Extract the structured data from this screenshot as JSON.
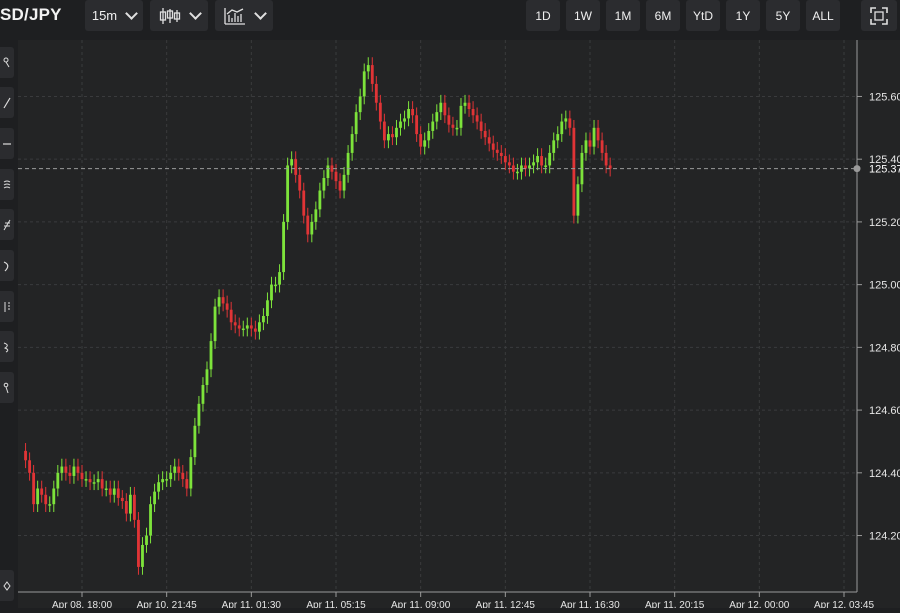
{
  "toolbar": {
    "symbol": "SD/JPY",
    "interval": "15m",
    "chart_type_icon": "candlestick-icon",
    "indicators_icon": "indicators-icon",
    "ranges": [
      "1D",
      "1W",
      "1M",
      "6M",
      "YtD",
      "1Y",
      "5Y",
      "ALL"
    ],
    "fullscreen_icon": "fullscreen-icon"
  },
  "left_tools": [
    "crosshair-icon",
    "trend-line-icon",
    "horizontal-line-icon",
    "pitchfork-icon",
    "fibonacci-icon",
    "pattern-icon",
    "measure-icon",
    "brush-icon",
    "annotation-icon",
    "settings-icon"
  ],
  "colors": {
    "background": "#232425",
    "up": "#7de33b",
    "down": "#e03436",
    "grid": "#3a3b3d",
    "axis_text": "#e6e6e6"
  },
  "chart_data": {
    "type": "candlestick",
    "grid": true,
    "y_ticks": [
      "124.20",
      "124.40",
      "124.60",
      "124.80",
      "125.00",
      "125.20",
      "125.40",
      "125.60"
    ],
    "ylim": [
      124.02,
      125.78
    ],
    "x_ticks": [
      "Apr 08, 18:00",
      "Apr 10, 21:45",
      "Apr 11, 01:30",
      "Apr 11, 05:15",
      "Apr 11, 09:00",
      "Apr 11, 12:45",
      "Apr 11, 16:30",
      "Apr 11, 20:15",
      "Apr 12, 00:00",
      "Apr 12, 03:45"
    ],
    "x_tick_indices": [
      14,
      35,
      56,
      77,
      98,
      119,
      140,
      161,
      182,
      203
    ],
    "last_price": "125.37",
    "last_value": 125.37,
    "closes": [
      124.44,
      124.4,
      124.3,
      124.35,
      124.33,
      124.3,
      124.3,
      124.35,
      124.4,
      124.42,
      124.4,
      124.39,
      124.42,
      124.4,
      124.38,
      124.38,
      124.37,
      124.37,
      124.38,
      124.35,
      124.35,
      124.33,
      124.35,
      124.32,
      124.31,
      124.27,
      124.33,
      124.25,
      124.1,
      124.17,
      124.2,
      124.3,
      124.34,
      124.37,
      124.38,
      124.38,
      124.4,
      124.42,
      124.4,
      124.38,
      124.35,
      124.45,
      124.55,
      124.62,
      124.68,
      124.73,
      124.82,
      124.93,
      124.96,
      124.94,
      124.92,
      124.88,
      124.87,
      124.86,
      124.86,
      124.87,
      124.86,
      124.85,
      124.88,
      124.9,
      124.95,
      125.0,
      125.0,
      125.04,
      125.2,
      125.38,
      125.4,
      125.35,
      125.3,
      125.22,
      125.16,
      125.2,
      125.24,
      125.3,
      125.34,
      125.38,
      125.36,
      125.33,
      125.3,
      125.35,
      125.42,
      125.48,
      125.55,
      125.6,
      125.68,
      125.7,
      125.64,
      125.58,
      125.52,
      125.46,
      125.48,
      125.47,
      125.5,
      125.52,
      125.53,
      125.56,
      125.54,
      125.48,
      125.44,
      125.46,
      125.49,
      125.52,
      125.55,
      125.58,
      125.54,
      125.51,
      125.5,
      125.5,
      125.57,
      125.58,
      125.56,
      125.54,
      125.52,
      125.49,
      125.47,
      125.45,
      125.43,
      125.42,
      125.41,
      125.39,
      125.38,
      125.36,
      125.36,
      125.38,
      125.37,
      125.38,
      125.39,
      125.41,
      125.38,
      125.38,
      125.42,
      125.46,
      125.48,
      125.52,
      125.53,
      125.5,
      125.22,
      125.32,
      125.42,
      125.46,
      125.44,
      125.5,
      125.46,
      125.42,
      125.38,
      125.37
    ],
    "opens": [
      124.47,
      124.44,
      124.4,
      124.3,
      124.35,
      124.33,
      124.3,
      124.3,
      124.35,
      124.4,
      124.42,
      124.4,
      124.39,
      124.42,
      124.4,
      124.38,
      124.38,
      124.37,
      124.37,
      124.38,
      124.35,
      124.35,
      124.33,
      124.35,
      124.32,
      124.31,
      124.27,
      124.33,
      124.25,
      124.1,
      124.17,
      124.2,
      124.3,
      124.34,
      124.37,
      124.38,
      124.38,
      124.4,
      124.42,
      124.4,
      124.38,
      124.35,
      124.45,
      124.55,
      124.62,
      124.68,
      124.73,
      124.82,
      124.93,
      124.96,
      124.94,
      124.92,
      124.88,
      124.87,
      124.86,
      124.86,
      124.87,
      124.86,
      124.85,
      124.88,
      124.9,
      124.95,
      125.0,
      125.0,
      125.04,
      125.2,
      125.38,
      125.4,
      125.35,
      125.3,
      125.22,
      125.16,
      125.2,
      125.24,
      125.3,
      125.34,
      125.38,
      125.36,
      125.33,
      125.3,
      125.35,
      125.42,
      125.48,
      125.55,
      125.6,
      125.68,
      125.7,
      125.64,
      125.58,
      125.52,
      125.46,
      125.48,
      125.47,
      125.5,
      125.52,
      125.53,
      125.56,
      125.54,
      125.48,
      125.44,
      125.46,
      125.49,
      125.52,
      125.55,
      125.58,
      125.54,
      125.51,
      125.5,
      125.5,
      125.57,
      125.58,
      125.56,
      125.54,
      125.52,
      125.49,
      125.47,
      125.45,
      125.43,
      125.42,
      125.41,
      125.39,
      125.38,
      125.36,
      125.36,
      125.38,
      125.37,
      125.38,
      125.39,
      125.41,
      125.38,
      125.38,
      125.42,
      125.46,
      125.48,
      125.52,
      125.53,
      125.5,
      125.22,
      125.32,
      125.42,
      125.46,
      125.44,
      125.5,
      125.46,
      125.42,
      125.38
    ]
  }
}
